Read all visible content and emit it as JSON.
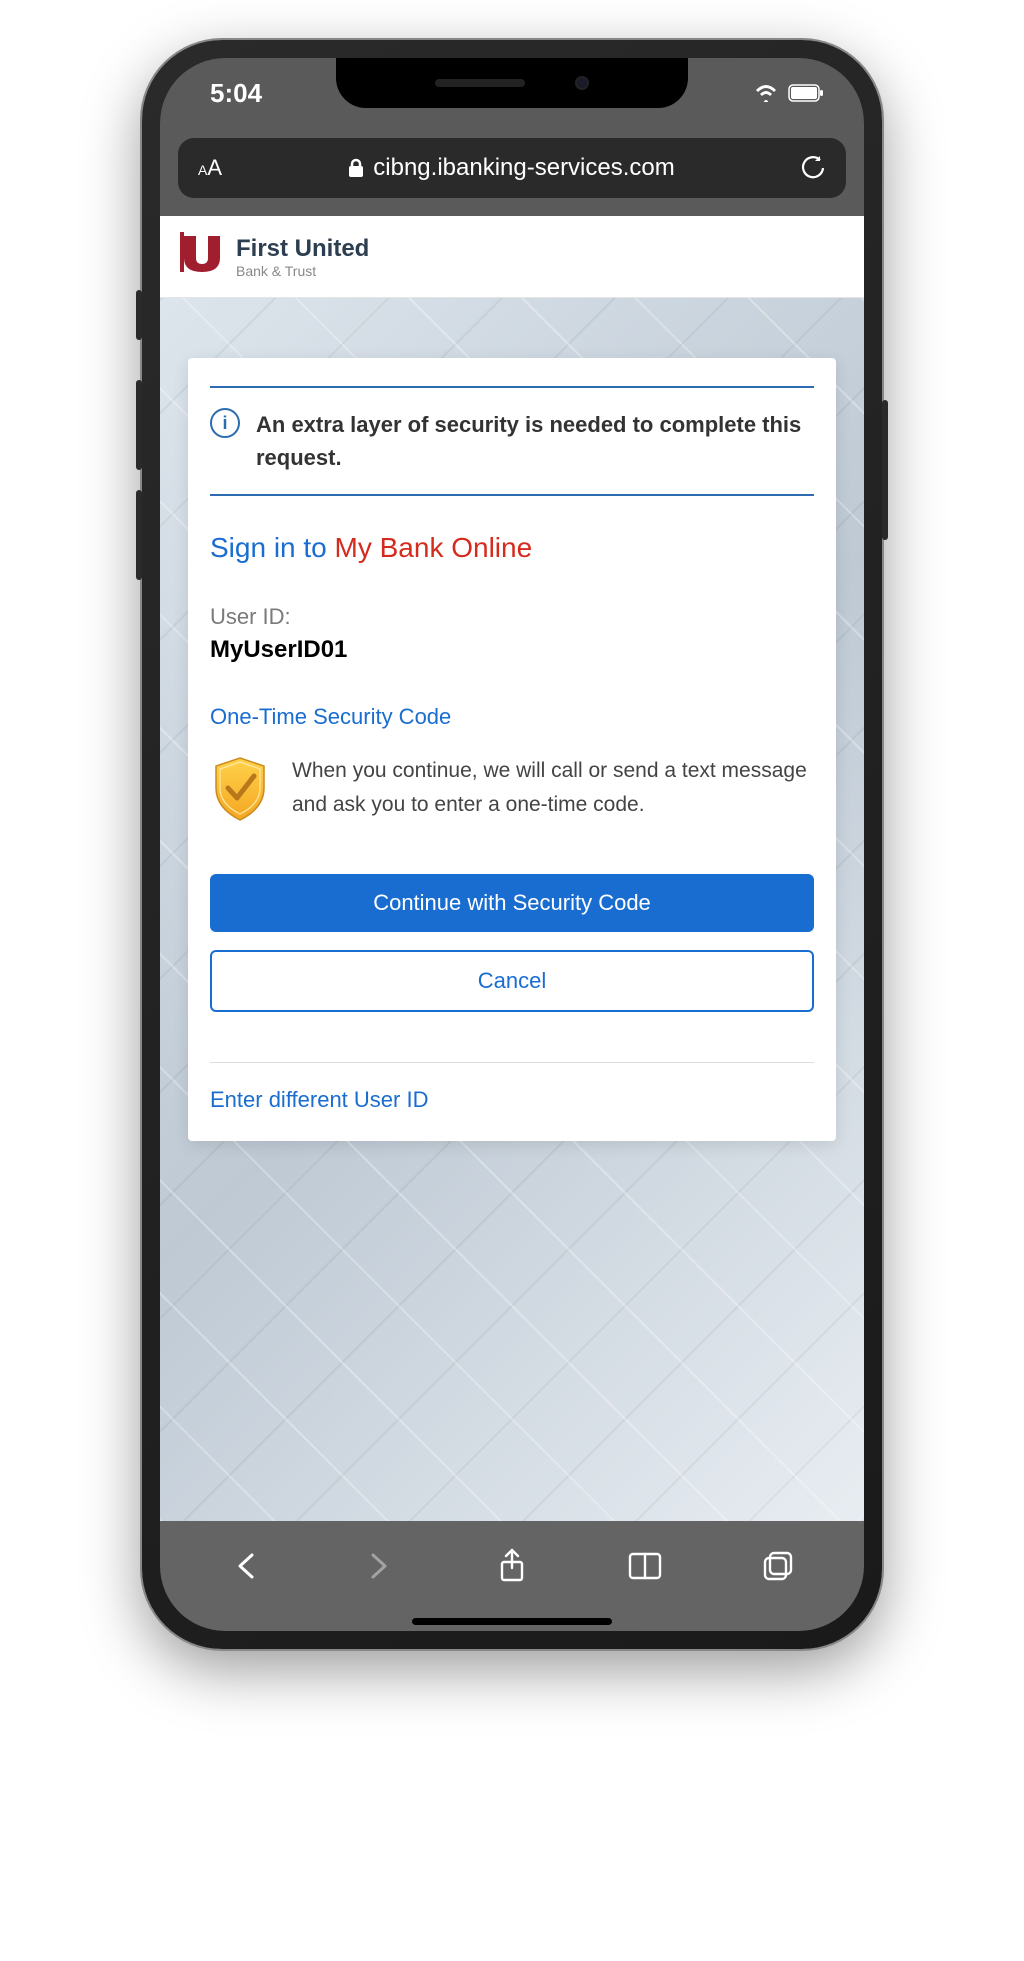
{
  "status": {
    "time": "5:04"
  },
  "address_bar": {
    "text_size_label": "AA",
    "url": "cibng.ibanking-services.com"
  },
  "bank": {
    "logo_glyph": "u",
    "name": "First United",
    "tagline": "Bank & Trust"
  },
  "banner": {
    "info_glyph": "i",
    "message": "An extra layer of security is needed to complete this request."
  },
  "signin": {
    "prefix": "Sign in to",
    "brand": "My Bank Online"
  },
  "user": {
    "label": "User ID:",
    "value": "MyUserID01"
  },
  "otsc": {
    "heading": "One-Time Security Code",
    "description": "When you continue, we will call or send a text message and ask you to enter a one-time code."
  },
  "buttons": {
    "continue": "Continue with Security Code",
    "cancel": "Cancel"
  },
  "links": {
    "different_user": "Enter different User ID"
  },
  "colors": {
    "brand_blue": "#1a6dd0",
    "brand_red": "#d52b1e",
    "bank_red": "#a01e2e"
  }
}
